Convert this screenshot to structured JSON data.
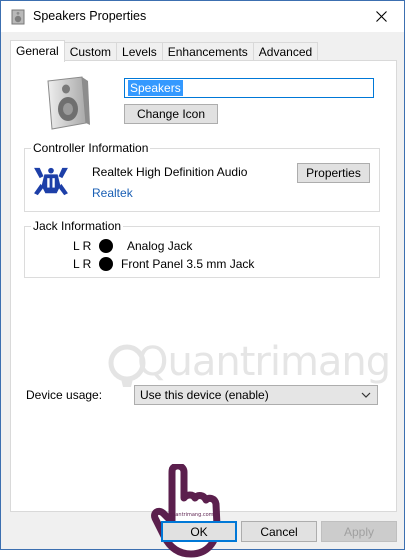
{
  "window": {
    "title": "Speakers Properties",
    "close_icon": "close-icon"
  },
  "tabs": [
    {
      "label": "General",
      "active": true
    },
    {
      "label": "Custom",
      "active": false
    },
    {
      "label": "Levels",
      "active": false
    },
    {
      "label": "Enhancements",
      "active": false
    },
    {
      "label": "Advanced",
      "active": false
    }
  ],
  "general": {
    "device_name": "Speakers",
    "change_icon_label": "Change Icon"
  },
  "controller": {
    "group_label": "Controller Information",
    "device": "Realtek High Definition Audio",
    "vendor_link": "Realtek",
    "properties_label": "Properties"
  },
  "jack": {
    "group_label": "Jack Information",
    "rows": [
      {
        "channels": "L R",
        "name": "Analog Jack"
      },
      {
        "channels": "L R",
        "name": "Front Panel 3.5 mm Jack"
      }
    ]
  },
  "device_usage": {
    "label": "Device usage:",
    "selected": "Use this device (enable)"
  },
  "footer": {
    "ok_label": "OK",
    "cancel_label": "Cancel",
    "apply_label": "Apply"
  },
  "watermark": {
    "text": "Quantrimang"
  },
  "colors": {
    "accent": "#0078d7",
    "link": "#1a5fb4",
    "watermark": "#d0d0d0",
    "hand": "#5b1f4d"
  }
}
